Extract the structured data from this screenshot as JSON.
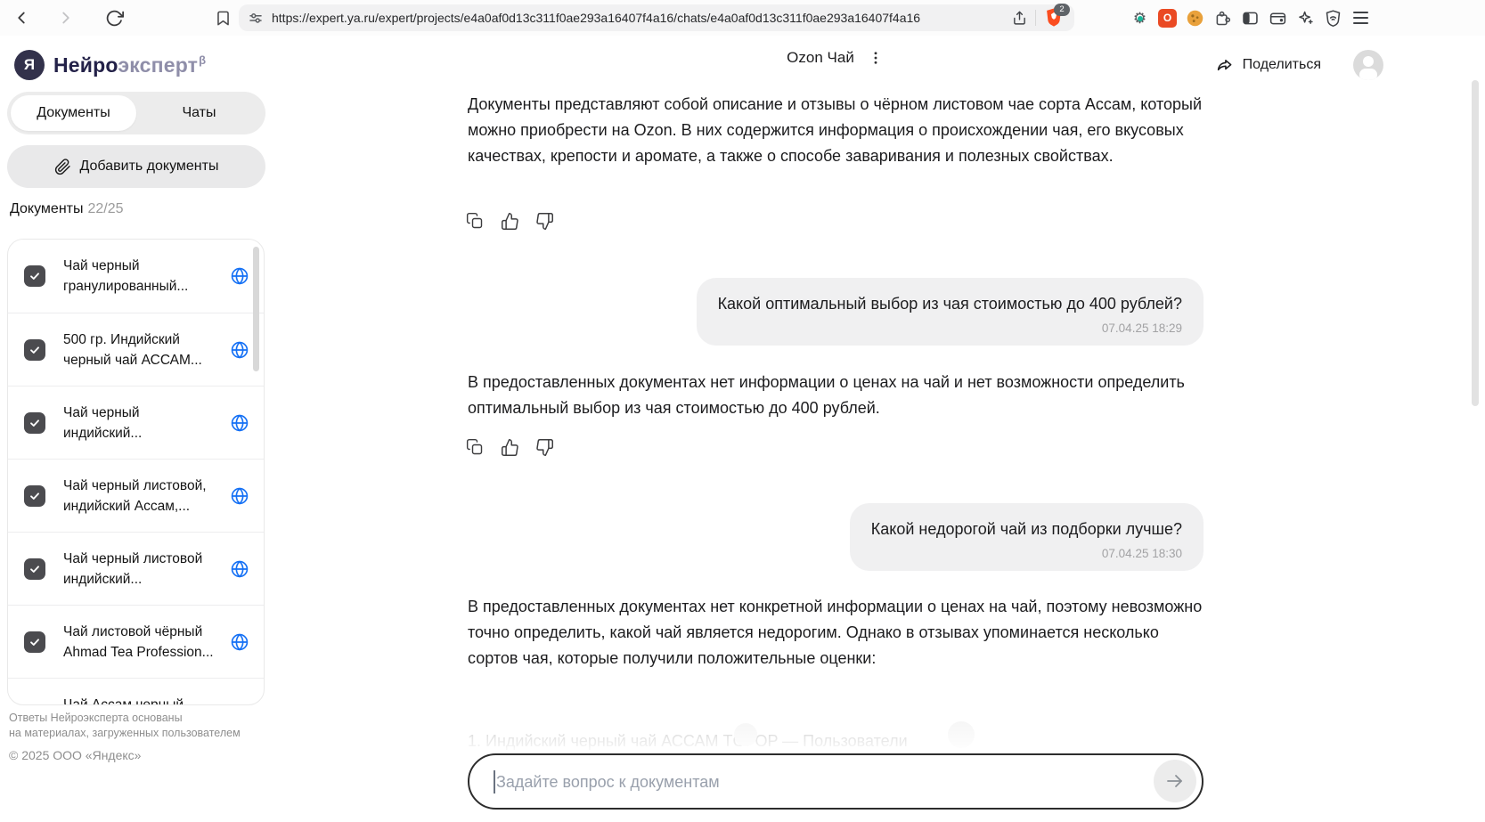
{
  "browser": {
    "url": "https://expert.ya.ru/expert/projects/e4a0af0d13c311f0ae293a16407f4a16/chats/e4a0af0d13c311f0ae293a16407f4a16",
    "shield_badge": "2"
  },
  "icons": {
    "logo_glyph": "Я",
    "gear_glyph": "⚙",
    "orange_app_glyph": "O"
  },
  "sidebar": {
    "brand": {
      "name_bold": "Нейро",
      "name_light": "эксперт",
      "beta": "β"
    },
    "tabs": {
      "documents": "Документы",
      "chats": "Чаты"
    },
    "add_button": "Добавить документы",
    "counter_label": "Документы",
    "counter_value": "22/25",
    "documents": [
      "Чай черный гранулированный...",
      "500 гр. Индийский черный чай АССАМ...",
      "Чай черный индийский...",
      "Чай черный листовой, индийский Ассам,...",
      "Чай черный листовой индийский...",
      "Чай листовой чёрный Ahmad Tea Profession...",
      "Чай Ассам черный"
    ],
    "footer_line1": "Ответы Нейроэксперта основаны",
    "footer_line2": "на материалах, загруженных пользователем",
    "copyright": "© 2025 ООО «Яндекс»"
  },
  "header": {
    "title": "Ozon Чай",
    "share_label": "Поделиться"
  },
  "chat": {
    "messages": [
      {
        "role": "assistant",
        "text": "Документы представляют собой описание и отзывы о чёрном листовом чае сорта Ассам, который можно приобрести на Ozon. В них содержится информация о происхождении чая, его вкусовых качествах, крепости и аромате, а также о способе заваривания и полезных свойствах."
      },
      {
        "role": "user",
        "text": "Какой оптимальный выбор из чая стоимостью до 400 рублей?",
        "time": "07.04.25 18:29"
      },
      {
        "role": "assistant",
        "text": "В предоставленных документах нет информации о ценах на чай и нет возможности определить оптимальный выбор из чая стоимостью до 400 рублей."
      },
      {
        "role": "user",
        "text": "Какой недорогой чай из подборки лучше?",
        "time": "07.04.25 18:30"
      },
      {
        "role": "assistant",
        "text": "В предоставленных документах нет конкретной информации о ценах на чай, поэтому невозможно точно определить, какой чай является недорогим. Однако в отзывах упоминается несколько сортов чая, которые получили положительные оценки:"
      },
      {
        "role": "assistant",
        "truncated": true,
        "text": "1. Индийский черный чай АССАМ TGFOP — Пользователи"
      }
    ]
  },
  "composer": {
    "placeholder": "Задайте вопрос к документам"
  }
}
